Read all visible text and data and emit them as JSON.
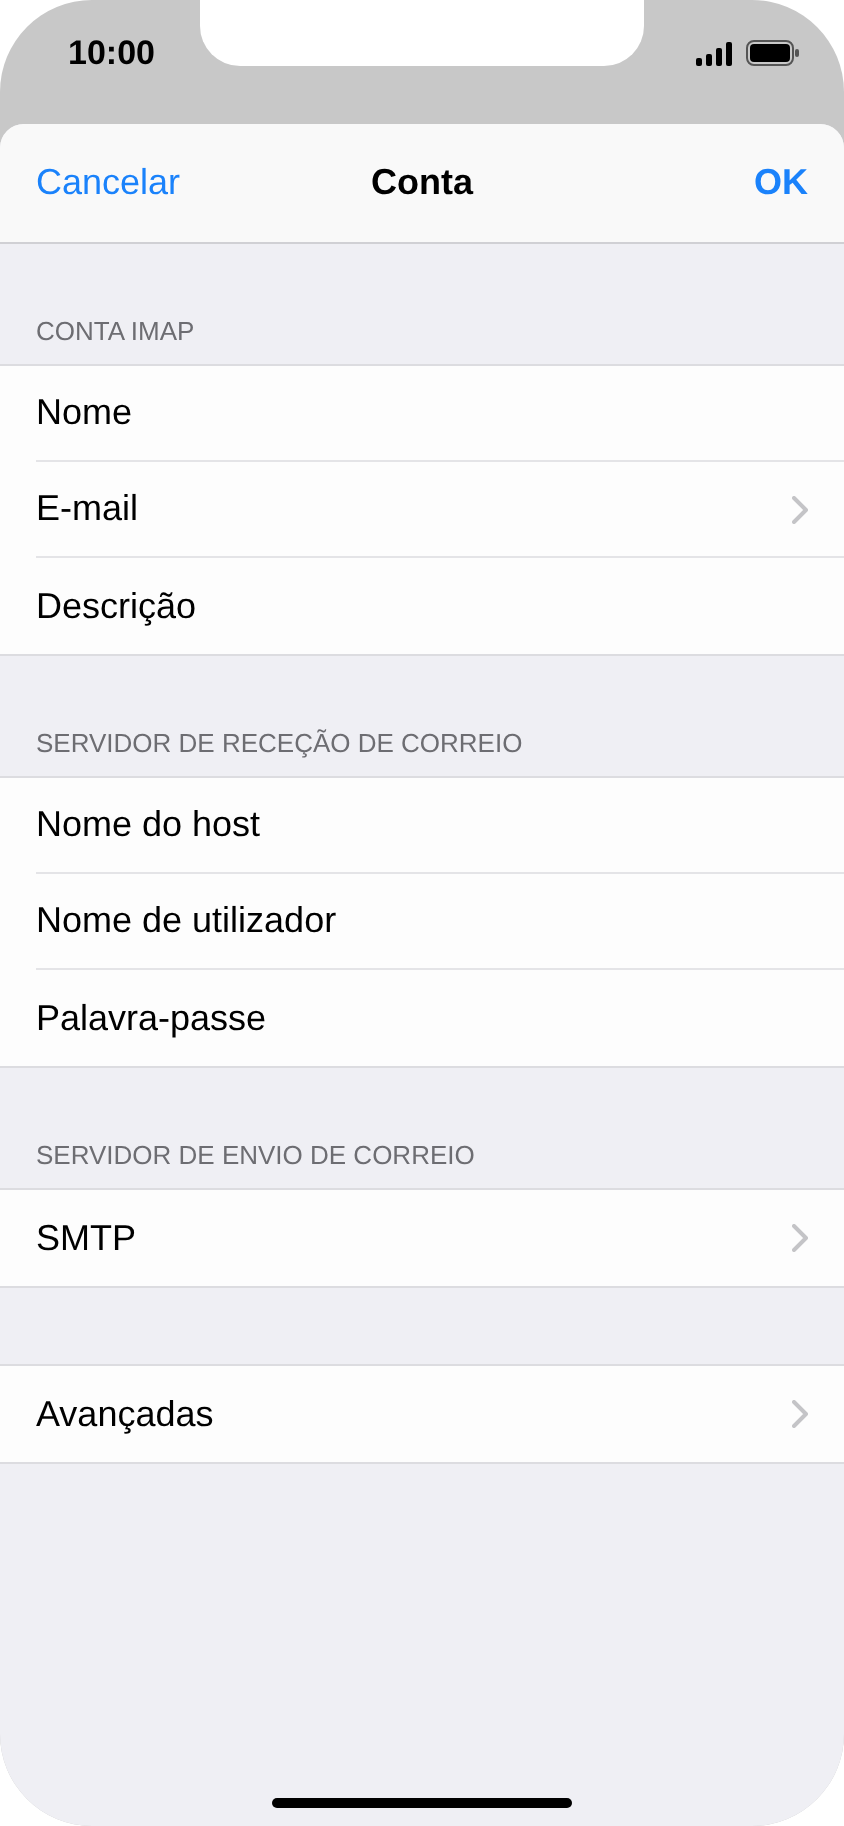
{
  "status_bar": {
    "time": "10:00"
  },
  "nav": {
    "cancel": "Cancelar",
    "title": "Conta",
    "ok": "OK"
  },
  "sections": [
    {
      "header": "CONTA IMAP",
      "rows": [
        {
          "label": "Nome",
          "chevron": false
        },
        {
          "label": "E-mail",
          "chevron": true
        },
        {
          "label": "Descrição",
          "chevron": false
        }
      ]
    },
    {
      "header": "SERVIDOR DE RECEÇÃO DE CORREIO",
      "rows": [
        {
          "label": "Nome do host",
          "chevron": false
        },
        {
          "label": "Nome de utilizador",
          "chevron": false
        },
        {
          "label": "Palavra-passe",
          "chevron": false
        }
      ]
    },
    {
      "header": "SERVIDOR DE ENVIO DE CORREIO",
      "rows": [
        {
          "label": "SMTP",
          "chevron": true
        }
      ]
    },
    {
      "rows": [
        {
          "label": "Avançadas",
          "chevron": true
        }
      ]
    }
  ]
}
